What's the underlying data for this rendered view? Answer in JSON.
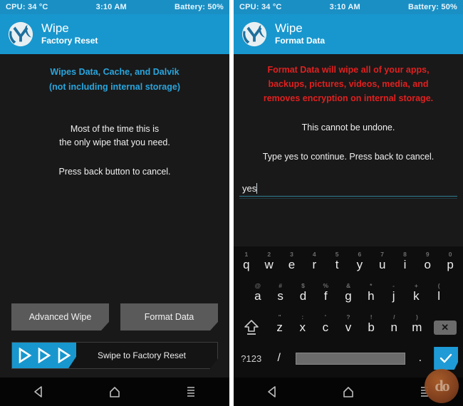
{
  "statusbar": {
    "cpu": "CPU: 34 °C",
    "time": "3:10 AM",
    "battery": "Battery: 50%"
  },
  "left_panel": {
    "header": {
      "title": "Wipe",
      "subtitle": "Factory Reset",
      "logo_icon": "twrp-logo-icon"
    },
    "notes": {
      "blue_line1": "Wipes Data, Cache, and Dalvik",
      "blue_line2": "(not including internal storage)",
      "white_line1": "Most of the time this is",
      "white_line2": "the only wipe that you need.",
      "white_line3": "Press back button to cancel."
    },
    "buttons": {
      "advanced_wipe": "Advanced Wipe",
      "format_data": "Format Data"
    },
    "swipe": {
      "label": "Swipe to Factory Reset",
      "arrow_glyph": "▷",
      "accent_color": "#1897ce"
    }
  },
  "right_panel": {
    "header": {
      "title": "Wipe",
      "subtitle": "Format Data",
      "logo_icon": "twrp-logo-icon"
    },
    "notes": {
      "red_line1": "Format Data will wipe all of your apps,",
      "red_line2": "backups, pictures, videos, media, and",
      "red_line3": "removes encryption on internal storage.",
      "white_line1": "This cannot be undone.",
      "white_line2": "Type yes to continue.  Press back to cancel."
    },
    "input": {
      "value": "yes",
      "placeholder": ""
    },
    "keyboard": {
      "row1": [
        {
          "key": "q",
          "sup": "1"
        },
        {
          "key": "w",
          "sup": "2"
        },
        {
          "key": "e",
          "sup": "3"
        },
        {
          "key": "r",
          "sup": "4"
        },
        {
          "key": "t",
          "sup": "5"
        },
        {
          "key": "y",
          "sup": "6"
        },
        {
          "key": "u",
          "sup": "7"
        },
        {
          "key": "i",
          "sup": "8"
        },
        {
          "key": "o",
          "sup": "9"
        },
        {
          "key": "p",
          "sup": "0"
        }
      ],
      "row2": [
        {
          "key": "a",
          "sup": "@"
        },
        {
          "key": "s",
          "sup": "#"
        },
        {
          "key": "d",
          "sup": "$"
        },
        {
          "key": "f",
          "sup": "%"
        },
        {
          "key": "g",
          "sup": "&"
        },
        {
          "key": "h",
          "sup": "*"
        },
        {
          "key": "j",
          "sup": "-"
        },
        {
          "key": "k",
          "sup": "+"
        },
        {
          "key": "l",
          "sup": "("
        }
      ],
      "row3": [
        {
          "key": "z",
          "sup": "\""
        },
        {
          "key": "x",
          "sup": ":"
        },
        {
          "key": "c",
          "sup": "'"
        },
        {
          "key": "v",
          "sup": "?"
        },
        {
          "key": "b",
          "sup": "!"
        },
        {
          "key": "n",
          "sup": "/"
        },
        {
          "key": "m",
          "sup": ")"
        }
      ],
      "shift_icon": "shift-key-icon",
      "backspace_icon": "backspace-key-icon",
      "backspace_glyph": "✕",
      "symbols_key": "?123",
      "slash_key": "/",
      "space_key": "",
      "period_key": ".",
      "enter_icon": "enter-check-icon",
      "enter_glyph": "✓"
    }
  },
  "navbar": {
    "back_icon": "back-triangle-icon",
    "home_icon": "home-house-icon",
    "recents_icon": "menu-lines-icon"
  },
  "watermark": {
    "text": "do",
    "name": "site-watermark-logo"
  },
  "colors": {
    "statusbar_blue": "#1a8fc4",
    "header_blue": "#1897ce",
    "accent_blue": "#29a5dd",
    "warn_red": "#e02020",
    "screen_bg": "#191919",
    "button_gray": "#5a5a5a"
  }
}
